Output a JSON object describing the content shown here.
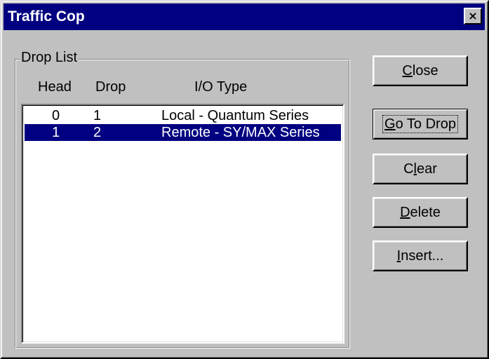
{
  "window": {
    "title": "Traffic Cop",
    "close_glyph": "×"
  },
  "drop_list": {
    "label": "Drop List",
    "columns": [
      "Head",
      "Drop",
      "I/O Type"
    ],
    "rows": [
      {
        "head": "0",
        "drop": "1",
        "io_type": "Local - Quantum Series",
        "selected": false
      },
      {
        "head": "1",
        "drop": "2",
        "io_type": "Remote - SY/MAX Series",
        "selected": true
      }
    ]
  },
  "buttons": {
    "close": {
      "mnemonic": "C",
      "rest": "lose"
    },
    "go_to_drop": {
      "mnemonic": "G",
      "rest": "o To Drop"
    },
    "clear": {
      "pre": "C",
      "mnemonic": "l",
      "rest": "ear"
    },
    "delete": {
      "mnemonic": "D",
      "rest": "elete"
    },
    "insert": {
      "mnemonic": "I",
      "rest": "nsert..."
    }
  },
  "colors": {
    "titlebar": "#000080",
    "selection": "#000080",
    "face": "#c0c0c0"
  }
}
